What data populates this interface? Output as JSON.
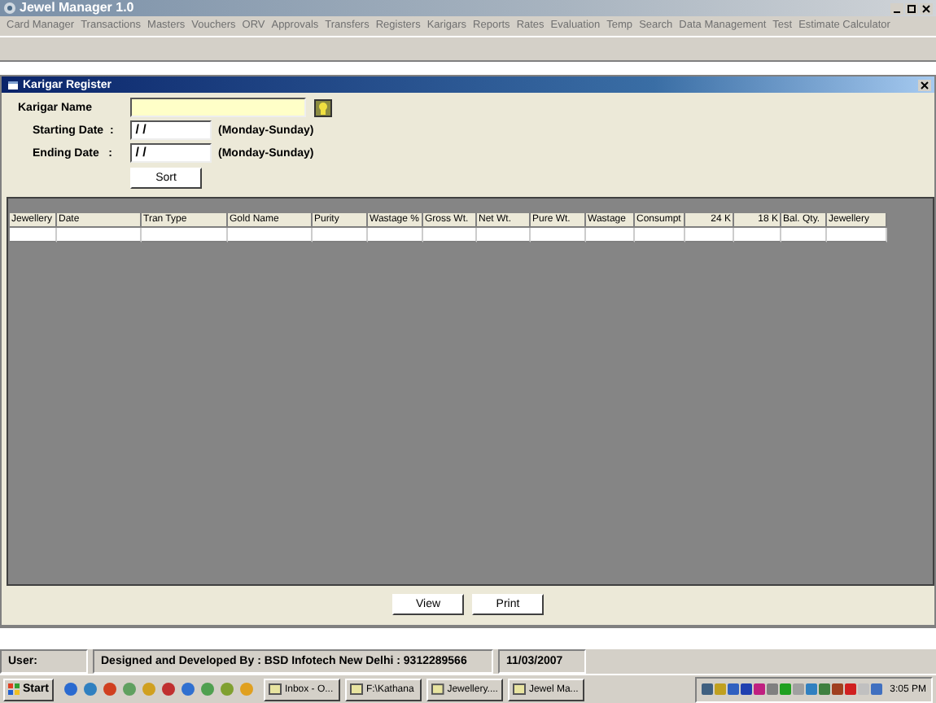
{
  "window": {
    "title": "Jewel Manager 1.0"
  },
  "menu": [
    "Card Manager",
    "Transactions",
    "Masters",
    "Vouchers",
    "ORV",
    "Approvals",
    "Transfers",
    "Registers",
    "Karigars",
    "Reports",
    "Rates",
    "Evaluation",
    "Temp",
    "Search",
    "Data Management",
    "Test",
    "Estimate Calculator"
  ],
  "child_window": {
    "title": "Karigar Register"
  },
  "form": {
    "fields": [
      {
        "kind": "lookup",
        "label": "Karigar Name"
      },
      {
        "kind": "date",
        "label": "Starting Date  :",
        "value": " / /",
        "hint": "(Monday-Sunday)"
      },
      {
        "kind": "date",
        "label": "Ending Date   :",
        "value": " / /",
        "hint": "(Monday-Sunday)"
      }
    ],
    "sort_button": "Sort"
  },
  "table": {
    "columns": [
      {
        "label": "Jewellery",
        "kind": "text"
      },
      {
        "label": "Date",
        "kind": "text"
      },
      {
        "label": "Tran Type",
        "kind": "text"
      },
      {
        "label": "Gold Name",
        "kind": "text"
      },
      {
        "label": "Purity",
        "kind": "text"
      },
      {
        "label": "Wastage %",
        "kind": "text"
      },
      {
        "label": "Gross Wt.",
        "kind": "text"
      },
      {
        "label": "Net Wt.",
        "kind": "text"
      },
      {
        "label": "Pure Wt.",
        "kind": "text"
      },
      {
        "label": "Wastage",
        "kind": "text"
      },
      {
        "label": "Consumpt",
        "kind": "text"
      },
      {
        "label": "24 K",
        "kind": "number"
      },
      {
        "label": "18 K",
        "kind": "number"
      },
      {
        "label": "Bal. Qty.",
        "kind": "text"
      },
      {
        "label": "Jewellery",
        "kind": "text"
      }
    ]
  },
  "buttons": [
    "View",
    "Print"
  ],
  "status_bar": [
    "User:",
    "Designed and Developed By : BSD Infotech New Delhi : 9312289566",
    "11/03/2007"
  ],
  "taskbar": {
    "start": "Start",
    "tasks": [
      "Inbox - O...",
      "F:\\Kathana",
      "Jewellery....",
      "Jewel Ma..."
    ],
    "clock": "3:05 PM"
  }
}
